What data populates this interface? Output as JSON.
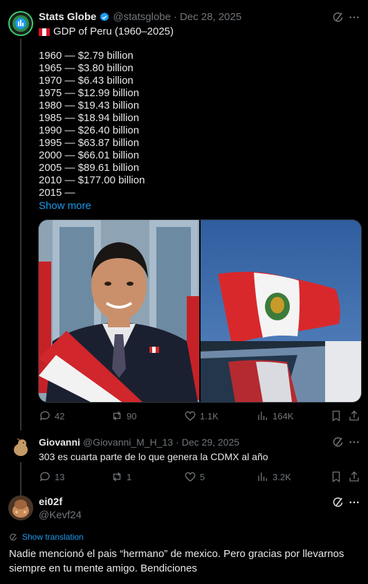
{
  "colors": {
    "background": "#000000",
    "text": "#e7e9ea",
    "muted": "#71767b",
    "link": "#1d9bf0",
    "verified": "#1d9bf0"
  },
  "main_post": {
    "author": {
      "name": "Stats Globe",
      "handle": "@statsglobe",
      "date": "Dec 28, 2025",
      "verified": true
    },
    "title": "GDP of Peru (1960–2025)",
    "lines": [
      "1960 — $2.79 billion",
      "1965 — $3.80 billion",
      "1970 — $6.43 billion",
      "1975 — $12.99 billion",
      "1980 — $19.43 billion",
      "1985 — $18.94 billion",
      "1990 — $26.40 billion",
      "1995 — $63.87 billion",
      "2000 — $66.01 billion",
      "2005 — $89.61 billion",
      "2010 — $177.00 billion",
      "2015 —"
    ],
    "show_more": "Show more",
    "stats": {
      "replies": "42",
      "reposts": "90",
      "likes": "1.1K",
      "views": "164K"
    }
  },
  "reply_1": {
    "author": {
      "name": "Giovanni",
      "handle": "@Giovanni_M_H_13",
      "date": "Dec 29, 2025"
    },
    "text": "303 es cuarta parte de lo que genera la CDMX al año",
    "stats": {
      "replies": "13",
      "reposts": "1",
      "likes": "5",
      "views": "3.2K"
    }
  },
  "reply_2": {
    "author": {
      "name": "ei02f",
      "handle": "@Kevf24"
    },
    "translate": "Show translation",
    "text": "Nadie mencionó el pais “hermano” de mexico. Pero gracias por llevarnos siempre en tu mente amigo. Bendiciones"
  },
  "separator": "·"
}
